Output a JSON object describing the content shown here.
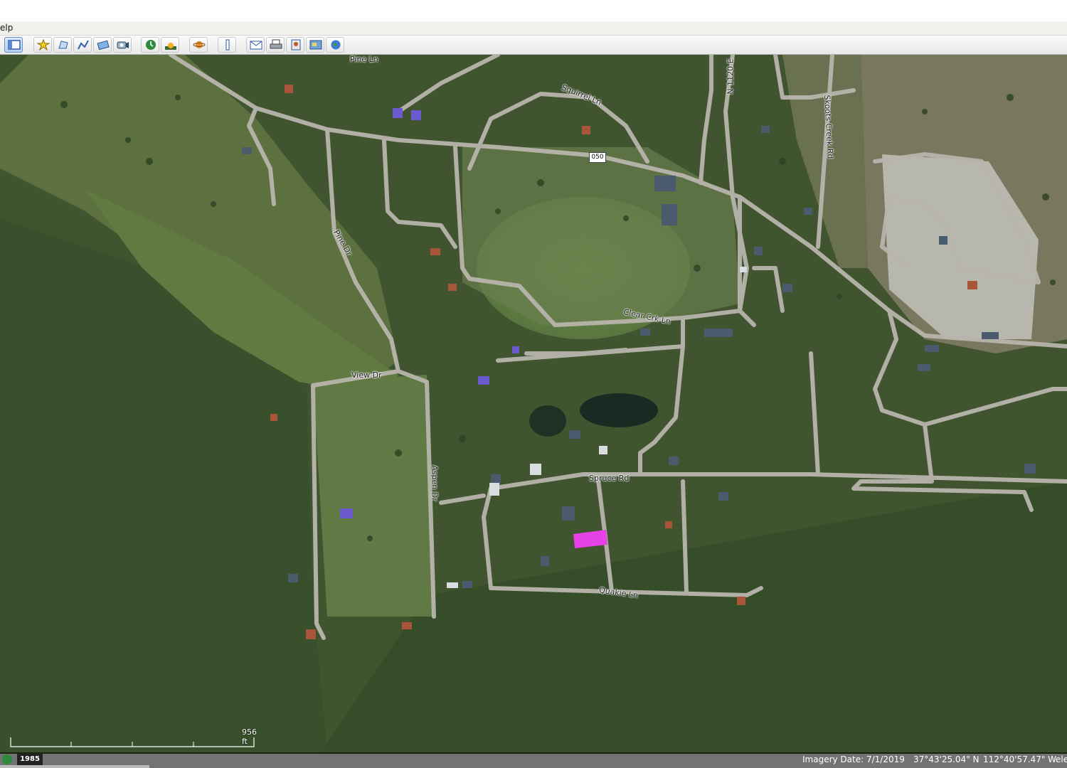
{
  "menu": {
    "help_label": "elp"
  },
  "toolbar": {
    "buttons": [
      {
        "name": "sidebar-toggle-button",
        "icon": "sidebar-icon"
      },
      {
        "name": "add-placemark-button",
        "icon": "placemark-icon"
      },
      {
        "name": "add-polygon-button",
        "icon": "polygon-icon"
      },
      {
        "name": "add-path-button",
        "icon": "path-icon"
      },
      {
        "name": "add-image-overlay-button",
        "icon": "image-overlay-icon"
      },
      {
        "name": "record-tour-button",
        "icon": "tour-icon"
      },
      {
        "name": "historical-imagery-button",
        "icon": "clock-icon"
      },
      {
        "name": "sunlight-button",
        "icon": "sun-icon"
      },
      {
        "name": "planets-button",
        "icon": "planet-icon"
      },
      {
        "name": "ruler-button",
        "icon": "ruler-icon"
      },
      {
        "name": "email-button",
        "icon": "email-icon"
      },
      {
        "name": "print-button",
        "icon": "print-icon"
      },
      {
        "name": "save-image-button",
        "icon": "save-image-icon"
      },
      {
        "name": "view-in-maps-button",
        "icon": "maps-icon"
      },
      {
        "name": "earth-button",
        "icon": "globe-icon"
      }
    ]
  },
  "map": {
    "route_shield": "050",
    "road_labels": [
      {
        "name": "road-label-pine-ln",
        "text": "Pine Ln"
      },
      {
        "name": "road-label-squirrel-ln",
        "text": "Squirrel Ln"
      },
      {
        "name": "road-label-n-1120",
        "text": "N 1120 E"
      },
      {
        "name": "road-label-skoots-creek-rd",
        "text": "Skoots Creek Rd"
      },
      {
        "name": "road-label-pine-dr",
        "text": "Pine Dr"
      },
      {
        "name": "road-label-clear-crk-ln",
        "text": "Clear Crk Ln"
      },
      {
        "name": "road-label-view-dr",
        "text": "View Dr"
      },
      {
        "name": "road-label-aspen-dr",
        "text": "Aspen Dr"
      },
      {
        "name": "road-label-spruce-rd",
        "text": "Spruce Rd"
      },
      {
        "name": "road-label-quakie-ln",
        "text": "Quakie Ln"
      }
    ],
    "highlight_color": "#e641e6"
  },
  "scale": {
    "label": "956 ft"
  },
  "status": {
    "year": "1985",
    "imagery_date": "Imagery Date: 7/1/2019",
    "lat": "37°43'25.04\" N",
    "lon": "112°40'57.47\" W",
    "elev": "ele"
  }
}
